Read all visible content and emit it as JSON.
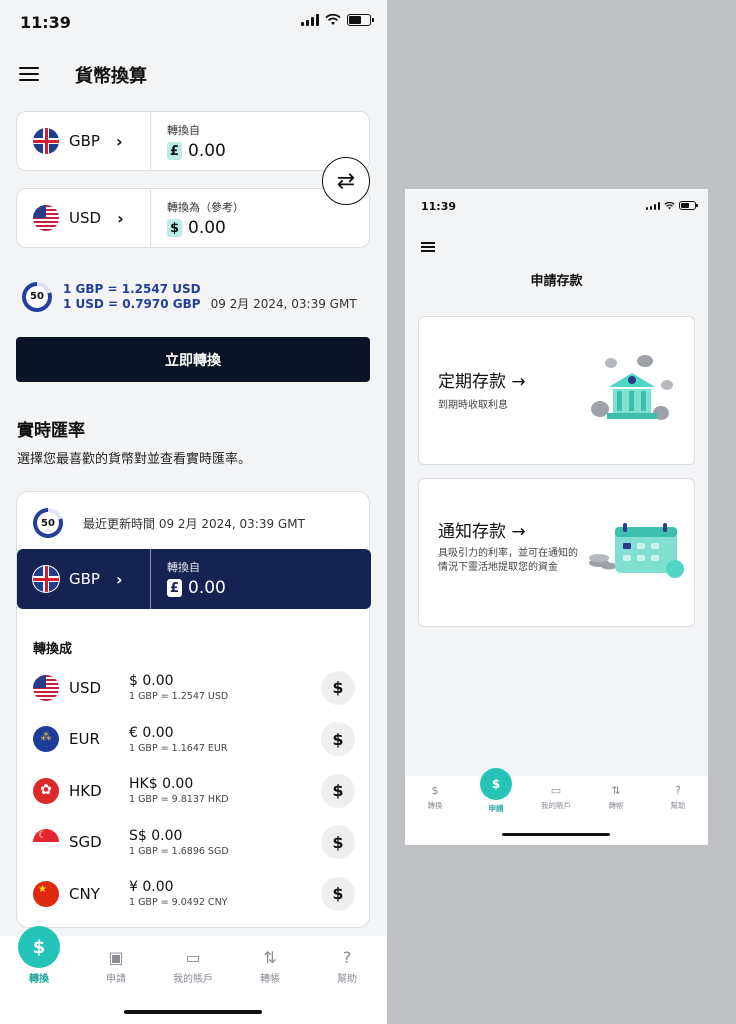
{
  "left": {
    "status": {
      "time": "11:39"
    },
    "title": "貨幣換算",
    "from": {
      "currency": "GBP",
      "label": "轉換自",
      "symbol": "£",
      "amount": "0.00"
    },
    "to": {
      "currency": "USD",
      "label": "轉換為（參考）",
      "symbol": "$",
      "amount": "0.00"
    },
    "rate": {
      "timer": "50",
      "line1": "1 GBP = 1.2547 USD",
      "line2": "1 USD = 0.7970 GBP",
      "date": "09 2月 2024, 03:39 GMT"
    },
    "convert_button": "立即轉換",
    "live_rates": {
      "title": "實時匯率",
      "subtitle": "選擇您最喜歡的貨幣對並查看實時匯率。",
      "timer": "50",
      "updated": "最近更新時間 09 2月 2024, 03:39 GMT",
      "base": {
        "currency": "GBP",
        "label": "轉換自",
        "symbol": "£",
        "amount": "0.00"
      },
      "convert_to_title": "轉換成",
      "rows": [
        {
          "code": "USD",
          "amount": "$ 0.00",
          "rate": "1 GBP = 1.2547 USD",
          "flag": "usd"
        },
        {
          "code": "EUR",
          "amount": "€ 0.00",
          "rate": "1 GBP = 1.1647 EUR",
          "flag": "eur"
        },
        {
          "code": "HKD",
          "amount": "HK$ 0.00",
          "rate": "1 GBP = 9.8137 HKD",
          "flag": "hkd"
        },
        {
          "code": "SGD",
          "amount": "S$ 0.00",
          "rate": "1 GBP = 1.6896 SGD",
          "flag": "sgd"
        },
        {
          "code": "CNY",
          "amount": "¥ 0.00",
          "rate": "1 GBP = 9.0492 CNY",
          "flag": "cny"
        }
      ]
    },
    "tabs": [
      "轉換",
      "申請",
      "我的賬戶",
      "轉帳",
      "幫助"
    ]
  },
  "right": {
    "status": {
      "time": "11:39"
    },
    "title": "申請存款",
    "cards": [
      {
        "title": "定期存款 →",
        "subtitle": "到期時收取利息"
      },
      {
        "title": "通知存款 →",
        "subtitle": "具吸引力的利率，並可在通知的情況下靈活地提取您的資金"
      }
    ],
    "tabs": [
      "轉換",
      "申請",
      "我的賬戶",
      "轉帳",
      "幫助"
    ]
  },
  "colors": {
    "accent": "#25c4b9",
    "navy": "#152352",
    "primary_button": "#0b1426",
    "rate_text": "#233f9b"
  }
}
